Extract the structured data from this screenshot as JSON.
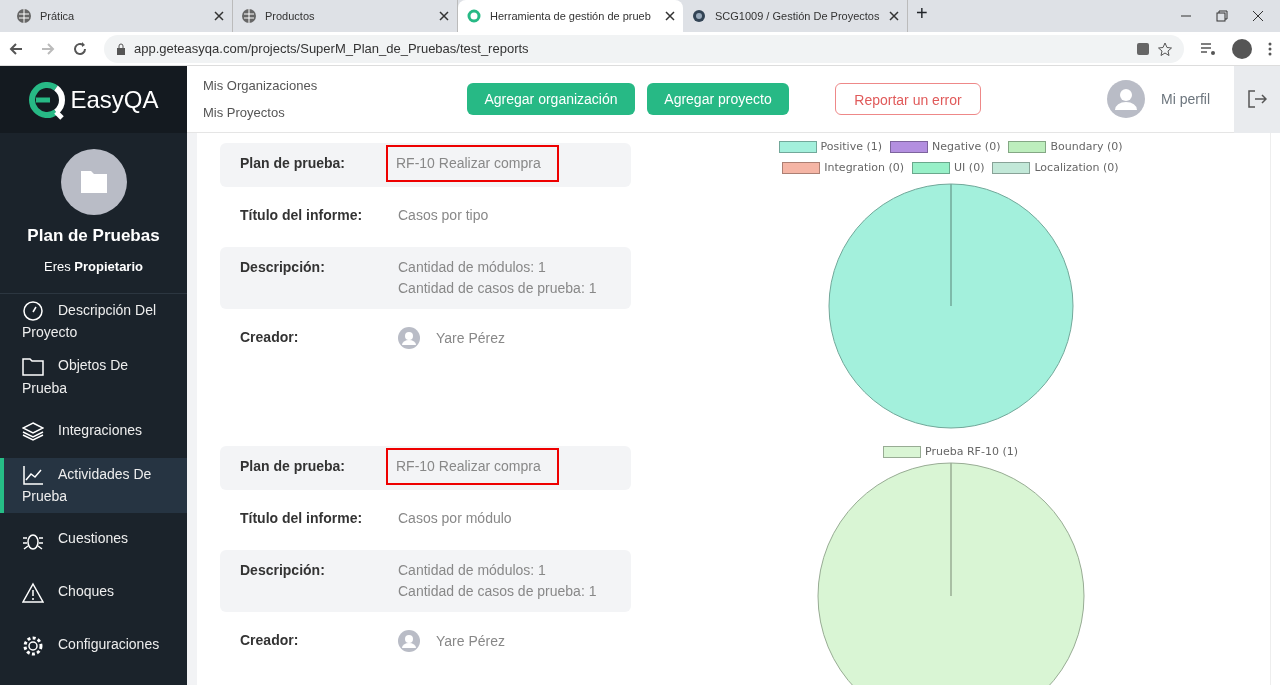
{
  "browser": {
    "tabs": [
      {
        "title": "Prática",
        "selected": false
      },
      {
        "title": "Productos",
        "selected": false
      },
      {
        "title": "Herramienta de gestión de prueb",
        "selected": true
      },
      {
        "title": "SCG1009 / Gestión De Proyectos",
        "selected": false
      }
    ],
    "new_tab": "+",
    "url": "app.geteasyqa.com/projects/SuperM_Plan_de_Pruebas/test_reports"
  },
  "logo": "EasyQA",
  "project": {
    "name": "Plan de Pruebas",
    "role_prefix": "Eres",
    "role": "Propietario"
  },
  "sidebar": {
    "items": [
      {
        "label": "Descripción Del Proyecto",
        "selected": false
      },
      {
        "label": "Objetos De Prueba",
        "selected": false
      },
      {
        "label": "Integraciones",
        "selected": false
      },
      {
        "label": "Actividades De Prueba",
        "selected": true
      },
      {
        "label": "Cuestiones",
        "selected": false
      },
      {
        "label": "Choques",
        "selected": false
      },
      {
        "label": "Configuraciones",
        "selected": false
      }
    ]
  },
  "header": {
    "links": [
      "Mis Organizaciones",
      "Mis Proyectos"
    ],
    "buttons": [
      {
        "label": "Agregar organización",
        "kind": "primary"
      },
      {
        "label": "Agregar proyecto",
        "kind": "primary"
      },
      {
        "label": "Reportar un error",
        "kind": "outline"
      }
    ],
    "profile": "Mi perfil"
  },
  "reports": [
    {
      "fields": [
        {
          "label": "Plan de prueba:",
          "lines": [
            "RF-10 Realizar compra"
          ],
          "shaded": true,
          "highlighted": true
        },
        {
          "label": "Título del informe:",
          "lines": [
            "Casos por tipo"
          ],
          "shaded": false,
          "highlighted": false
        },
        {
          "label": "Descripción:",
          "lines": [
            "Cantidad de módulos: 1",
            "Cantidad de casos de prueba: 1"
          ],
          "shaded": true,
          "highlighted": false
        },
        {
          "label": "Creador:",
          "lines": [
            "Yare Pérez"
          ],
          "shaded": false,
          "highlighted": false,
          "kind": "user"
        }
      ],
      "chart_data": {
        "type": "pie",
        "categories": [
          "Positive (1)",
          "Negative (0)",
          "Boundary (0)",
          "Integration (0)",
          "UI (0)",
          "Localization (0)"
        ],
        "series": [
          {
            "values": [
              1,
              0,
              0,
              0,
              0,
              0
            ]
          }
        ],
        "colors": [
          "#a3f0dc",
          "#b38fe0",
          "#bdeebd",
          "#f5b5a5",
          "#98f0c8",
          "#c2e8d8"
        ],
        "needle": "Positive (1)"
      }
    },
    {
      "fields": [
        {
          "label": "Plan de prueba:",
          "lines": [
            "RF-10 Realizar compra"
          ],
          "shaded": true,
          "highlighted": true
        },
        {
          "label": "Título del informe:",
          "lines": [
            "Casos por módulo"
          ],
          "shaded": false,
          "highlighted": false
        },
        {
          "label": "Descripción:",
          "lines": [
            "Cantidad de módulos: 1",
            "Cantidad de casos de prueba: 1"
          ],
          "shaded": true,
          "highlighted": false
        },
        {
          "label": "Creador:",
          "lines": [
            "Yare Pérez"
          ],
          "shaded": false,
          "highlighted": false,
          "kind": "user"
        }
      ],
      "chart_data": {
        "type": "pie",
        "categories": [
          "Prueba RF-10 (1)"
        ],
        "series": [
          {
            "values": [
              1
            ]
          }
        ],
        "colors": [
          "#d9f5d4"
        ],
        "needle": "Prueba RF-10 (1)"
      }
    }
  ]
}
